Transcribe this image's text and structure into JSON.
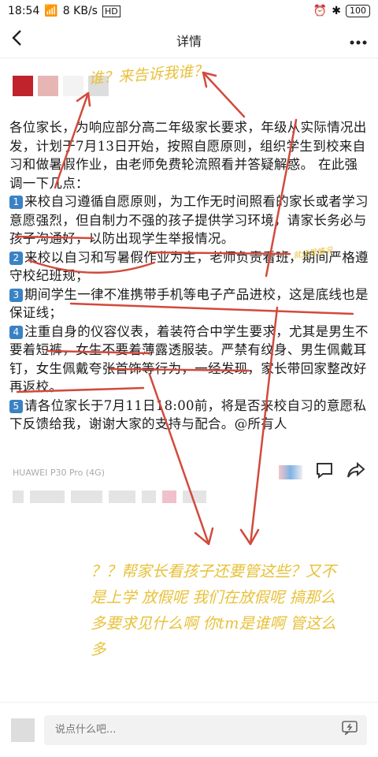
{
  "status_bar": {
    "time": "18:54",
    "net_speed": "8 KB/s",
    "hd": "HD",
    "battery": "100"
  },
  "nav": {
    "back_icon": "chevron-left-icon",
    "title": "详情",
    "more_icon": "more-horizontal-icon"
  },
  "doc": {
    "intro": "各位家长，为响应部分高二年级家长要求，年级从实际情况出发，计划于7月13日开始，按照自愿原则，组织学生到校来自习和做暑假作业，由老师免费轮流照看并答疑解惑。 在此强调一下几点：",
    "points": [
      {
        "num": "1",
        "text": "来校自习遵循自愿原则，为工作无时间照看的家长或者学习意愿强烈，但自制力不强的孩子提供学习环境，请家长务必与孩子沟通好，以防出现学生举报情况。"
      },
      {
        "num": "2",
        "text": "来校以自习和写暑假作业为主，老师负责看班，期间严格遵守校纪班规；"
      },
      {
        "num": "3",
        "text": "期间学生一律不准携带手机等电子产品进校，这是底线也是保证线；"
      },
      {
        "num": "4",
        "text": "注重自身的仪容仪表，着装符合中学生要求，尤其是男生不要着短裤，女生不要着薄露透服装。严禁有纹身、男生佩戴耳钉，女生佩戴夸张首饰等行为，一经发现，家长带回家整改好再返校。"
      },
      {
        "num": "5",
        "text": "请各位家长于7月11日18:00前，将是否来校自习的意愿私下反馈给我，谢谢大家的支持与配合。@所有人"
      }
    ]
  },
  "device": "HUAWEI P30 Pro (4G)",
  "annotations": {
    "top": "谁？来告诉我谁？",
    "side": "就这是情况",
    "big": "？？帮家长看孩子还要管这些？又不是上学 放假呢 我们在放假呢 搞那么多要求见什么啊 你tm是谁啊 管这么多"
  },
  "actions": {
    "comment_icon": "comment-icon",
    "share_icon": "share-icon"
  },
  "bottom": {
    "placeholder": "说点什么吧...",
    "emoji_icon": "emoji-icon"
  },
  "colors": {
    "accent_blue": "#3b82c4",
    "annotation_red": "#d24a3c",
    "annotation_yellow": "#e8c13a"
  }
}
